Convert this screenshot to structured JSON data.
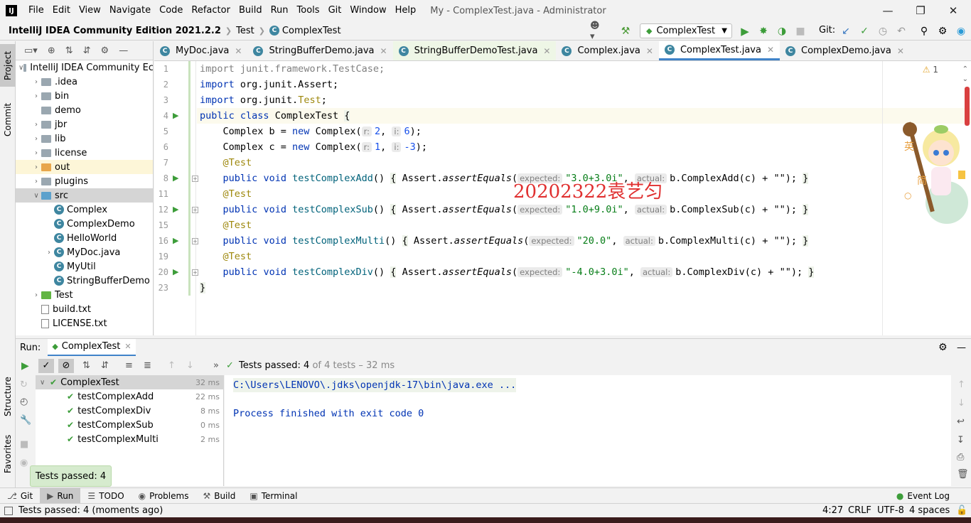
{
  "menubar": {
    "logo": "IJ",
    "items": [
      "File",
      "Edit",
      "View",
      "Navigate",
      "Code",
      "Refactor",
      "Build",
      "Run",
      "Tools",
      "Git",
      "Window",
      "Help"
    ],
    "window_title": "My - ComplexTest.java - Administrator"
  },
  "navbar": {
    "project": "IntelliJ IDEA Community Edition 2021.2.2",
    "crumb_folder": "Test",
    "crumb_class": "ComplexTest",
    "run_config": "ComplexTest",
    "git_label": "Git:"
  },
  "left_strip": {
    "project_tab": "Project",
    "commit_tab": "Commit",
    "structure_tab": "Structure",
    "favorites_tab": "Favorites"
  },
  "project_tree": [
    {
      "label": "IntelliJ IDEA Community Ec",
      "kind": "root",
      "indent": 0,
      "arrow": "v"
    },
    {
      "label": ".idea",
      "kind": "folder",
      "indent": 1,
      "arrow": ">"
    },
    {
      "label": "bin",
      "kind": "folder",
      "indent": 1,
      "arrow": ">"
    },
    {
      "label": "demo",
      "kind": "folder",
      "indent": 1,
      "arrow": ""
    },
    {
      "label": "jbr",
      "kind": "folder",
      "indent": 1,
      "arrow": ">"
    },
    {
      "label": "lib",
      "kind": "folder",
      "indent": 1,
      "arrow": ">"
    },
    {
      "label": "license",
      "kind": "folder",
      "indent": 1,
      "arrow": ">"
    },
    {
      "label": "out",
      "kind": "folder-orange",
      "indent": 1,
      "arrow": ">"
    },
    {
      "label": "plugins",
      "kind": "folder",
      "indent": 1,
      "arrow": ">"
    },
    {
      "label": "src",
      "kind": "folder-blue",
      "indent": 1,
      "arrow": "v"
    },
    {
      "label": "Complex",
      "kind": "class",
      "indent": 2,
      "arrow": ""
    },
    {
      "label": "ComplexDemo",
      "kind": "class",
      "indent": 2,
      "arrow": ""
    },
    {
      "label": "HelloWorld",
      "kind": "class",
      "indent": 2,
      "arrow": ""
    },
    {
      "label": "MyDoc.java",
      "kind": "class",
      "indent": 2,
      "arrow": ">"
    },
    {
      "label": "MyUtil",
      "kind": "class",
      "indent": 2,
      "arrow": ""
    },
    {
      "label": "StringBufferDemo",
      "kind": "class",
      "indent": 2,
      "arrow": ""
    },
    {
      "label": "Test",
      "kind": "folder-green",
      "indent": 1,
      "arrow": ">"
    },
    {
      "label": "build.txt",
      "kind": "file",
      "indent": 1,
      "arrow": ""
    },
    {
      "label": "LICENSE.txt",
      "kind": "file",
      "indent": 1,
      "arrow": ""
    }
  ],
  "editor_tabs": [
    {
      "label": "MyDoc.java"
    },
    {
      "label": "StringBufferDemo.java"
    },
    {
      "label": "StringBufferDemoTest.java"
    },
    {
      "label": "Complex.java"
    },
    {
      "label": "ComplexTest.java",
      "active": true
    },
    {
      "label": "ComplexDemo.java"
    }
  ],
  "editor": {
    "line_numbers": [
      "1",
      "2",
      "3",
      "4",
      "5",
      "6",
      "7",
      "8",
      "11",
      "12",
      "15",
      "16",
      "19",
      "20",
      "23"
    ],
    "warning_count": "1",
    "watermark": "20202322袁艺匀",
    "line1": {
      "kw": "import",
      "rest": " junit.framework.TestCase;"
    },
    "line2": {
      "kw": "import",
      "rest": " org.junit.Assert;"
    },
    "line3": {
      "kw": "import",
      "pre": " org.junit.",
      "ann": "Test",
      "post": ";"
    },
    "line4": {
      "kw1": "public",
      "kw2": "class",
      "name": " ComplexTest ",
      "brace": "{"
    },
    "line5": {
      "pre": "    Complex b = ",
      "kw": "new",
      "mid": " Complex(",
      "h1": "r:",
      "v1": "2",
      "sep": ", ",
      "h2": "i:",
      "v2": "6",
      "end": ");"
    },
    "line6": {
      "pre": "    Complex c = ",
      "kw": "new",
      "mid": " Complex(",
      "h1": "r:",
      "v1": "1",
      "sep": ", ",
      "h2": "i:",
      "v2": "-3",
      "end": ");"
    },
    "tests": [
      {
        "ann": "@Test",
        "name": "testComplexAdd",
        "expected": "\"3.0+3.0i\"",
        "call": "b.ComplexAdd(c) + \"\");"
      },
      {
        "ann": "@Test",
        "name": "testComplexSub",
        "expected": "\"1.0+9.0i\"",
        "call": "b.ComplexSub(c) + \"\");"
      },
      {
        "ann": "@Test",
        "name": "testComplexMulti",
        "expected": "\"20.0\"",
        "call": "b.ComplexMulti(c) + \"\");"
      },
      {
        "ann": "@Test",
        "name": "testComplexDiv",
        "expected": "\"-4.0+3.0i\"",
        "call": "b.ComplexDiv(c) + \"\");"
      }
    ],
    "kw_public": "public",
    "kw_void": "void",
    "assert_prefix": "Assert.",
    "assert_method": "assertEquals",
    "hint_expected": "expected:",
    "hint_actual": "actual:",
    "closing_brace": "}",
    "mascot_chars": [
      "英",
      "简"
    ]
  },
  "run_panel": {
    "label": "Run:",
    "tab": "ComplexTest",
    "status_passed": "Tests passed: 4",
    "status_rest": "of 4 tests – 32 ms",
    "tests": [
      {
        "name": "ComplexTest",
        "duration": "32 ms",
        "root": true
      },
      {
        "name": "testComplexAdd",
        "duration": "22 ms"
      },
      {
        "name": "testComplexDiv",
        "duration": "8 ms"
      },
      {
        "name": "testComplexSub",
        "duration": "0 ms"
      },
      {
        "name": "testComplexMulti",
        "duration": "2 ms"
      }
    ],
    "console_cmd": "C:\\Users\\LENOVO\\.jdks\\openjdk-17\\bin\\java.exe ...",
    "console_exit": "Process finished with exit code 0",
    "toast": "Tests passed: 4"
  },
  "bottom_tabs": [
    {
      "label": "Git",
      "icon": "git-icon"
    },
    {
      "label": "Run",
      "icon": "run-icon",
      "active": true
    },
    {
      "label": "TODO",
      "icon": "todo-icon"
    },
    {
      "label": "Problems",
      "icon": "problems-icon"
    },
    {
      "label": "Build",
      "icon": "build-icon"
    },
    {
      "label": "Terminal",
      "icon": "terminal-icon"
    }
  ],
  "event_log": "Event Log",
  "statusbar": {
    "message": "Tests passed: 4 (moments ago)",
    "position": "4:27",
    "line_sep": "CRLF",
    "encoding": "UTF-8",
    "indent": "4 spaces"
  },
  "colors": {
    "accent": "#4083c9",
    "pass": "#3d9d3a",
    "keyword": "#0033b3",
    "string": "#067d17",
    "annotation": "#9e880d",
    "watermark": "#e03030"
  }
}
